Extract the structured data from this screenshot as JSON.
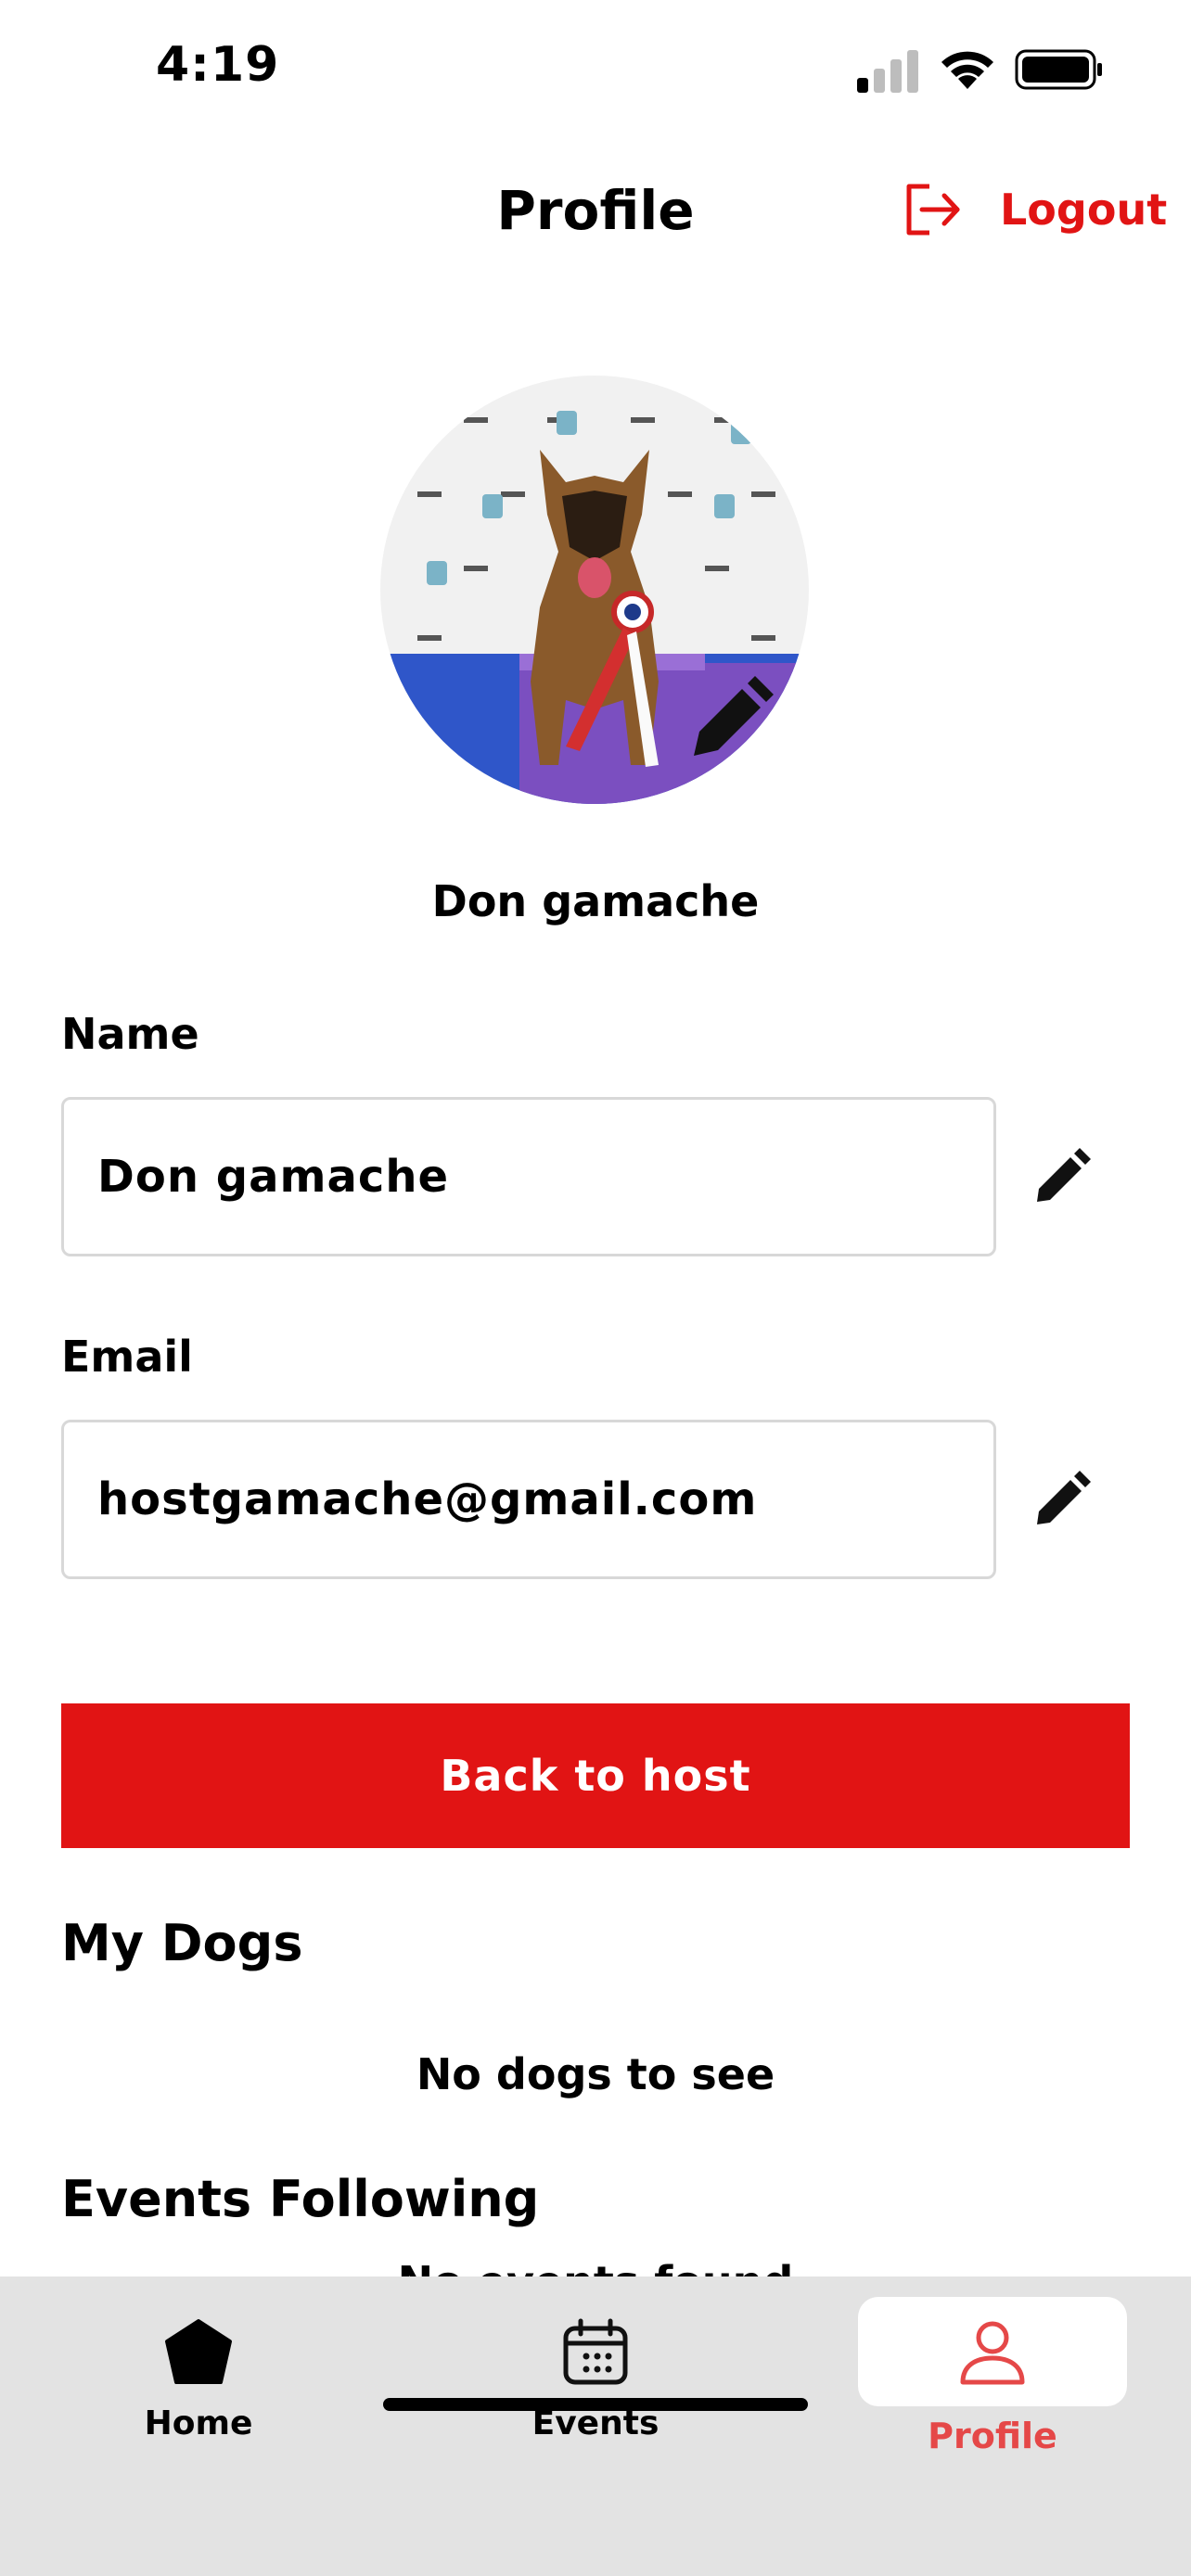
{
  "status_bar": {
    "time": "4:19"
  },
  "header": {
    "title": "Profile",
    "logout_label": "Logout"
  },
  "profile": {
    "display_name": "Don gamache"
  },
  "form": {
    "name_label": "Name",
    "name_value": "Don gamache",
    "email_label": "Email",
    "email_value": "hostgamache@gmail.com"
  },
  "actions": {
    "back_to_host_label": "Back to host"
  },
  "sections": {
    "my_dogs_title": "My Dogs",
    "my_dogs_empty": "No dogs to see",
    "events_following_title": "Events Following",
    "events_following_empty": "No events found"
  },
  "tab_bar": {
    "items": [
      {
        "label": "Home",
        "icon": "home-pentagon-icon"
      },
      {
        "label": "Events",
        "icon": "calendar-icon"
      },
      {
        "label": "Profile",
        "icon": "person-icon",
        "active": true
      }
    ]
  },
  "colors": {
    "accent": "#e11414",
    "tab_active": "#e54848",
    "tab_bar_bg": "#e3e3e3"
  }
}
